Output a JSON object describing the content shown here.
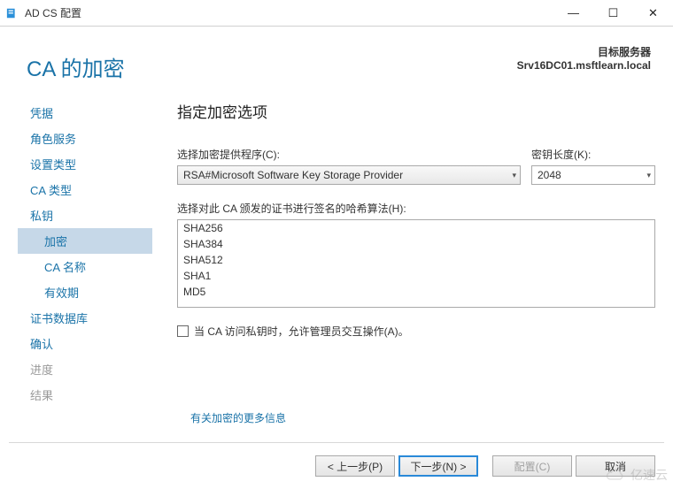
{
  "titlebar": {
    "title": "AD CS 配置"
  },
  "target": {
    "label": "目标服务器",
    "value": "Srv16DC01.msftlearn.local"
  },
  "page_title": "CA 的加密",
  "sidebar": {
    "items": [
      {
        "label": "凭据",
        "state": "normal"
      },
      {
        "label": "角色服务",
        "state": "normal"
      },
      {
        "label": "设置类型",
        "state": "normal"
      },
      {
        "label": "CA 类型",
        "state": "normal"
      },
      {
        "label": "私钥",
        "state": "normal"
      },
      {
        "label": "加密",
        "state": "selected",
        "sub": true
      },
      {
        "label": "CA 名称",
        "state": "normal",
        "sub": true
      },
      {
        "label": "有效期",
        "state": "normal",
        "sub": true
      },
      {
        "label": "证书数据库",
        "state": "normal"
      },
      {
        "label": "确认",
        "state": "normal"
      },
      {
        "label": "进度",
        "state": "disabled"
      },
      {
        "label": "结果",
        "state": "disabled"
      }
    ]
  },
  "main": {
    "heading": "指定加密选项",
    "provider_label": "选择加密提供程序(C):",
    "provider_value": "RSA#Microsoft Software Key Storage Provider",
    "keylen_label": "密钥长度(K):",
    "keylen_value": "2048",
    "hash_label": "选择对此 CA 颁发的证书进行签名的哈希算法(H):",
    "hash_options": [
      "SHA256",
      "SHA384",
      "SHA512",
      "SHA1",
      "MD5"
    ],
    "checkbox_label": "当 CA 访问私钥时，允许管理员交互操作(A)。",
    "more_link": "有关加密的更多信息"
  },
  "footer": {
    "prev": "< 上一步(P)",
    "next": "下一步(N) >",
    "config": "配置(C)",
    "cancel": "取消"
  },
  "watermark": "亿速云"
}
